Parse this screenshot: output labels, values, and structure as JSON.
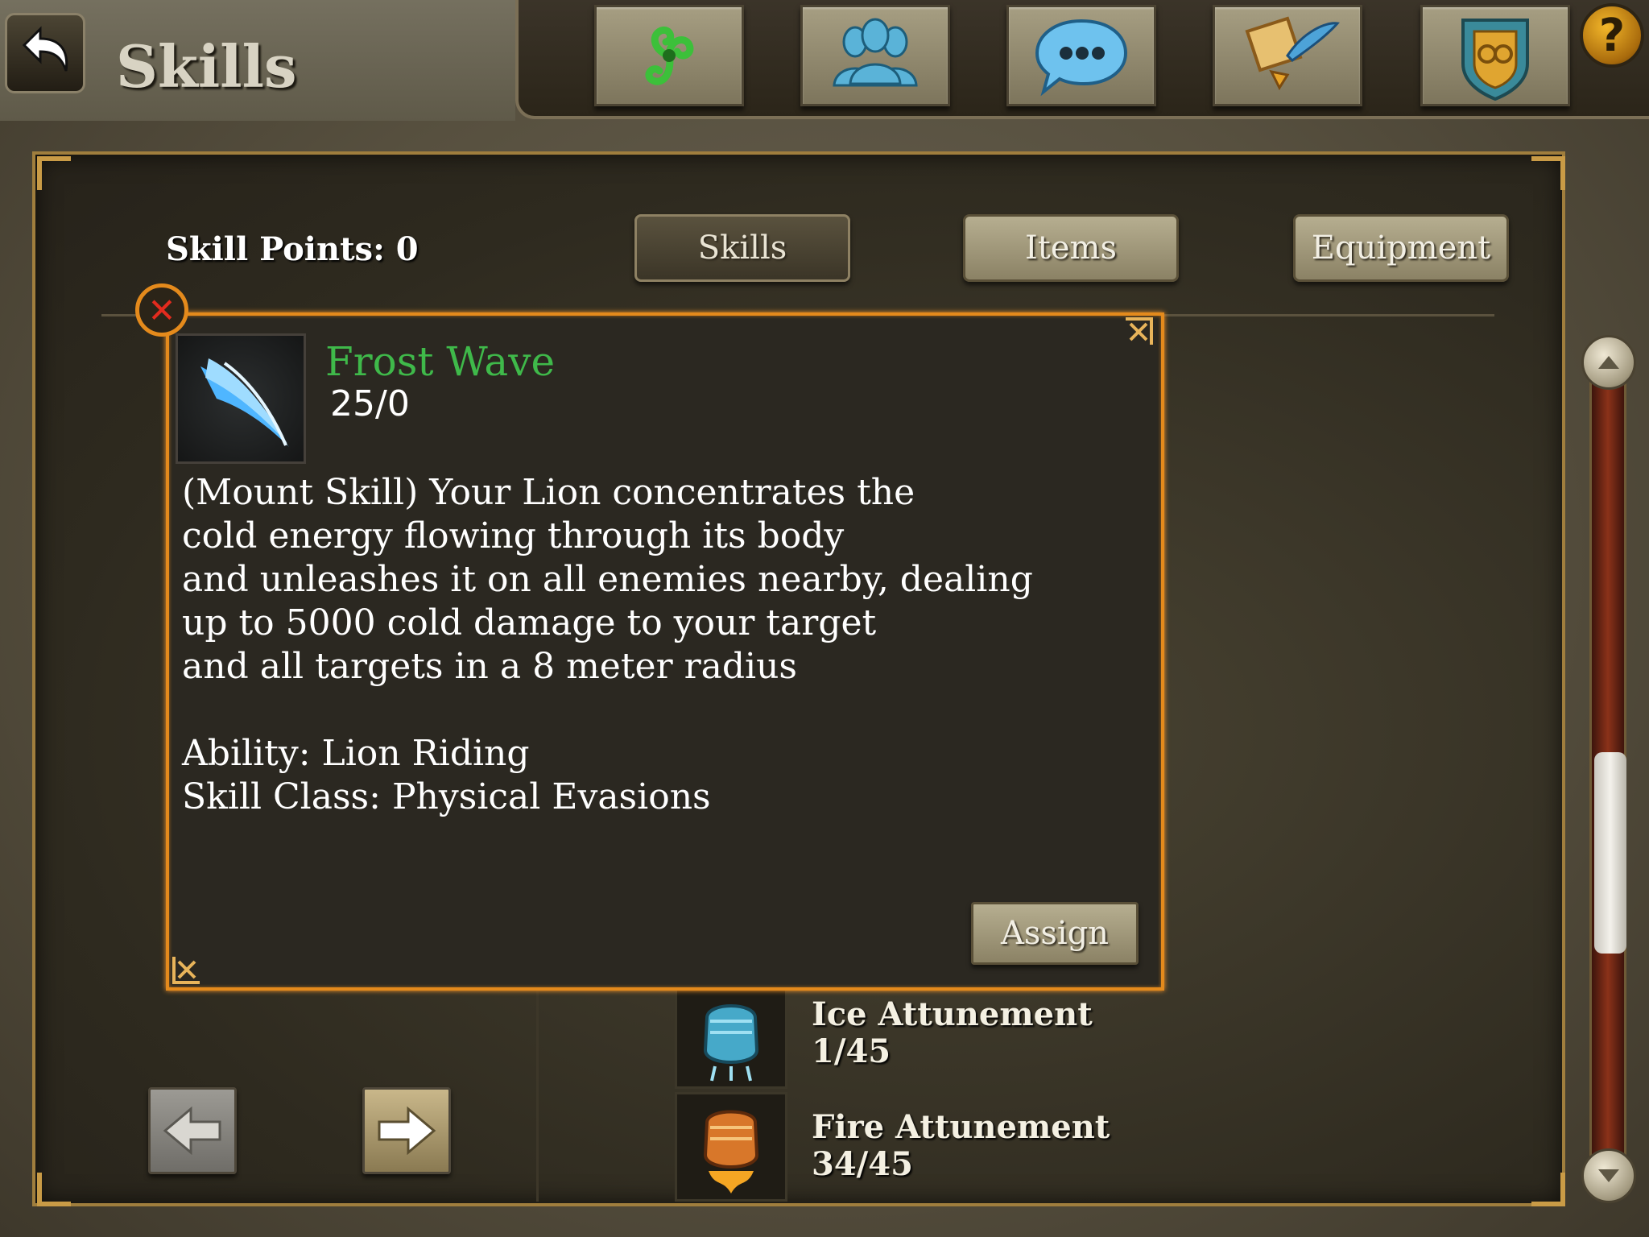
{
  "header": {
    "title": "Skills"
  },
  "topbar": {
    "icons": [
      "skill-tree-icon",
      "group-icon",
      "chat-icon",
      "quest-scroll-icon",
      "guild-shield-icon"
    ],
    "help_label": "?"
  },
  "panel": {
    "skill_points": "Skill Points: 0",
    "tabs": [
      {
        "label": "Skills",
        "active": true
      },
      {
        "label": "Items",
        "active": false
      },
      {
        "label": "Equipment",
        "active": false
      }
    ]
  },
  "popup": {
    "title": "Frost Wave",
    "level": "25/0",
    "description": [
      "(Mount Skill) Your Lion concentrates the",
      "cold energy flowing through its body",
      "and unleashes it on all enemies nearby, dealing",
      "up to 5000 cold damage to your target",
      "and all targets in a 8 meter radius"
    ],
    "ability": "Ability: Lion Riding",
    "skill_class": "Skill Class: Physical Evasions",
    "assign_label": "Assign",
    "close_label": "✕"
  },
  "skill_list": [
    {
      "name": "Ice Attunement",
      "level": "1/45",
      "icon": "ice-fist-icon"
    },
    {
      "name": "Fire Attunement",
      "level": "34/45",
      "icon": "fire-fist-icon"
    }
  ],
  "colors": {
    "popup_border": "#e48a1c",
    "skill_title": "#3fb94a",
    "scroll_track": "#8b3219"
  }
}
